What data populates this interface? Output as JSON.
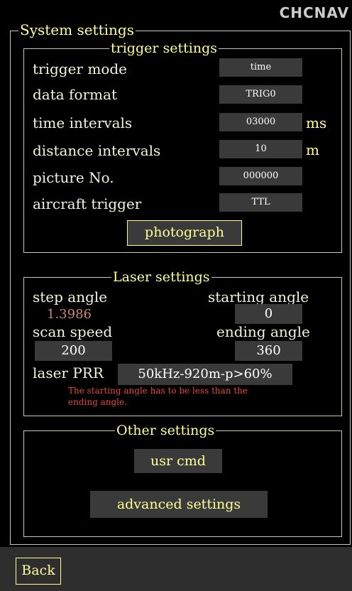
{
  "logo": "CHCNAV",
  "system_settings": {
    "title": "System settings"
  },
  "trigger": {
    "title": "trigger settings",
    "mode_label": "trigger mode",
    "mode_value": "time",
    "format_label": "data format",
    "format_value": "TRIG0",
    "time_label": "time intervals",
    "time_value": "03000",
    "time_unit": "ms",
    "distance_label": "distance intervals",
    "distance_value": "10",
    "distance_unit": "m",
    "picture_label": "picture No.",
    "picture_value": "000000",
    "aircraft_label": "aircraft trigger",
    "aircraft_value": "TTL",
    "photograph_button": "photograph"
  },
  "laser": {
    "title": "Laser settings",
    "step_label": "step angle",
    "step_value": "1.3986",
    "start_label": "starting angle",
    "start_value": "0",
    "scan_label": "scan speed",
    "scan_value": "200",
    "end_label": "ending angle",
    "end_value": "360",
    "prr_label": "laser PRR",
    "prr_value": "50kHz-920m-p>60%",
    "warning_line1": "The starting angle has to be less than the",
    "warning_line2": "ending angle."
  },
  "other": {
    "title": "Other settings",
    "usr_cmd_button": "usr cmd",
    "advanced_button": "advanced settings"
  },
  "footer": {
    "back_button": "Back"
  }
}
